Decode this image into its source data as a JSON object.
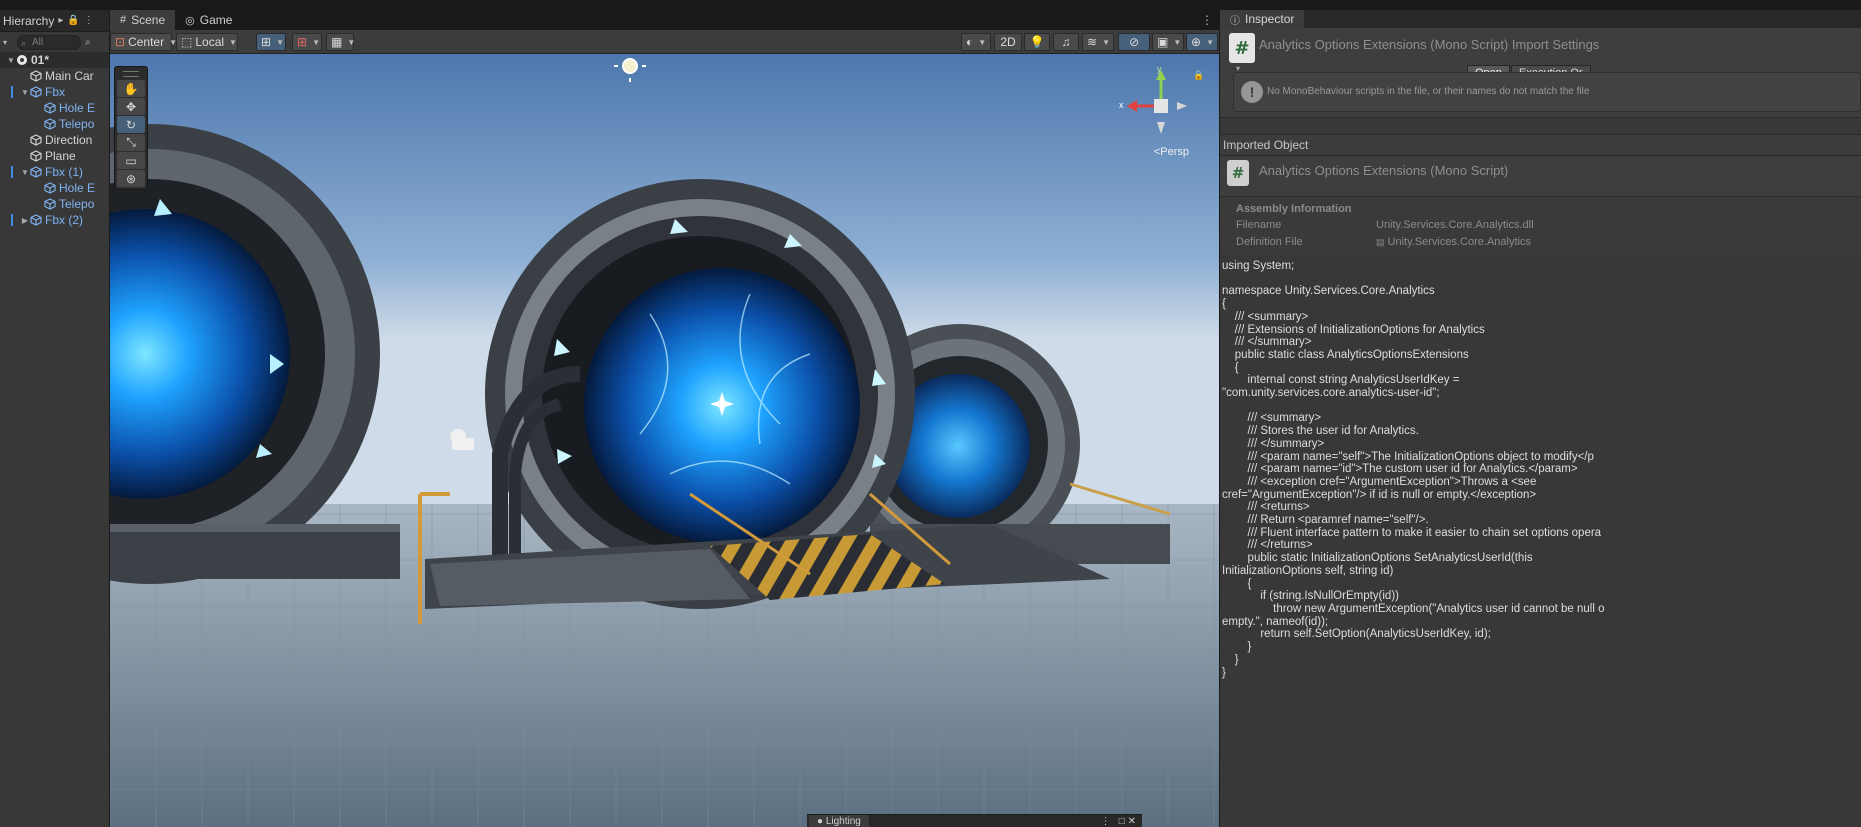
{
  "hierarchy": {
    "tab_label": "Hierarchy",
    "search_placeholder": "All",
    "items": [
      {
        "label": "01*",
        "type": "scene"
      },
      {
        "label": "Main Car",
        "type": "gameobject"
      },
      {
        "label": "Fbx",
        "type": "prefab"
      },
      {
        "label": "Hole E",
        "type": "prefab"
      },
      {
        "label": "Telepo",
        "type": "prefab"
      },
      {
        "label": "Direction",
        "type": "gameobject"
      },
      {
        "label": "Plane",
        "type": "gameobject"
      },
      {
        "label": "Fbx (1)",
        "type": "prefab"
      },
      {
        "label": "Hole E",
        "type": "prefab"
      },
      {
        "label": "Telepo",
        "type": "prefab"
      },
      {
        "label": "Fbx (2)",
        "type": "prefab"
      }
    ]
  },
  "scene": {
    "tabs": [
      {
        "label": "Scene",
        "icon": "grid-icon"
      },
      {
        "label": "Game",
        "icon": "gamepad-icon"
      }
    ],
    "toolbar": {
      "pivot_label": "Center",
      "space_label": "Local",
      "mode_2d_label": "2D"
    },
    "gizmo": {
      "persp_label": "Persp",
      "axis_x": "x",
      "axis_y": "y"
    }
  },
  "inspector": {
    "tab_label": "Inspector",
    "title": "Analytics Options Extensions (Mono Script) Import Settings",
    "open_button": "Open",
    "execution_order_button": "Execution Or",
    "warning": "No MonoBehaviour scripts in the file, or their names do not match the file",
    "imported_object_label": "Imported Object",
    "imported_object_title": "Analytics Options Extensions (Mono Script)",
    "assembly": {
      "header": "Assembly Information",
      "filename_label": "Filename",
      "filename_value": "Unity.Services.Core.Analytics.dll",
      "definition_label": "Definition File",
      "definition_value": "Unity.Services.Core.Analytics"
    },
    "code": "using System;\n\nnamespace Unity.Services.Core.Analytics\n{\n    /// <summary>\n    /// Extensions of InitializationOptions for Analytics\n    /// </summary>\n    public static class AnalyticsOptionsExtensions\n    {\n        internal const string AnalyticsUserIdKey =\n\"com.unity.services.core.analytics-user-id\";\n\n        /// <summary>\n        /// Stores the user id for Analytics.\n        /// </summary>\n        /// <param name=\"self\">The InitializationOptions object to modify</p\n        /// <param name=\"id\">The custom user id for Analytics.</param>\n        /// <exception cref=\"ArgumentException\">Throws a <see\ncref=\"ArgumentException\"/> if id is null or empty.</exception>\n        /// <returns>\n        /// Return <paramref name=\"self\"/>.\n        /// Fluent interface pattern to make it easier to chain set options opera\n        /// </returns>\n        public static InitializationOptions SetAnalyticsUserId(this\nInitializationOptions self, string id)\n        {\n            if (string.IsNullOrEmpty(id))\n                throw new ArgumentException(\"Analytics user id cannot be null o\nempty.\", nameof(id));\n            return self.SetOption(AnalyticsUserIdKey, id);\n        }\n    }\n}"
  },
  "bottom": {
    "lighting_tab": "Lighting"
  },
  "colors": {
    "accent_blue": "#3d8ee0",
    "prefab_text": "#7fb2f0",
    "selection": "#46607a",
    "portal_energy": "#2aa8ff",
    "sky_top": "#4d77ad",
    "sky_horizon": "#cfdbe8"
  }
}
